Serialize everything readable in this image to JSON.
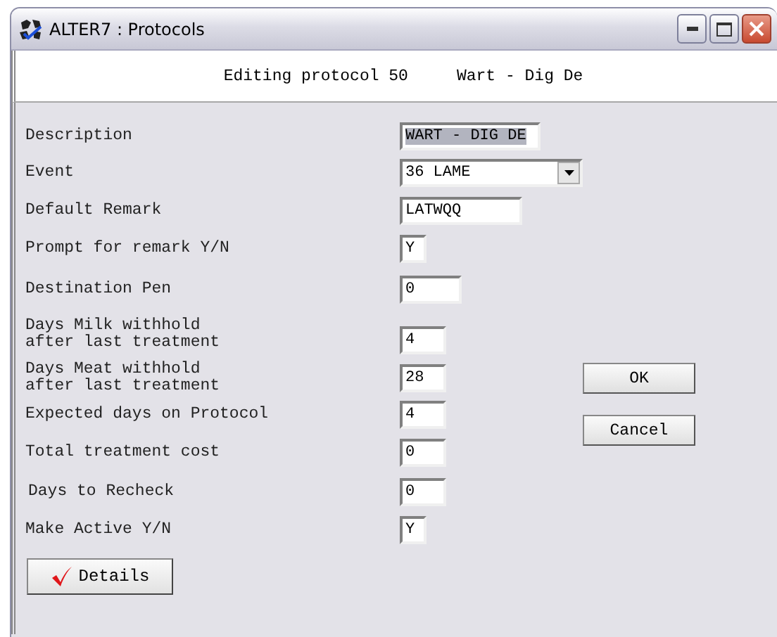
{
  "window": {
    "title": "ALTER7 : Protocols"
  },
  "header": {
    "text": "Editing protocol 50     Wart - Dig De"
  },
  "fields": [
    {
      "label": "Description",
      "kind": "text",
      "value": "WART - DIG DE",
      "highlighted": true
    },
    {
      "label": "Event",
      "kind": "dropdown",
      "value": "36 LAME",
      "highlighted": false
    },
    {
      "label": "Default Remark",
      "kind": "text",
      "value": "LATWQQ",
      "highlighted": false
    },
    {
      "label": "Prompt for remark Y/N",
      "kind": "text",
      "value": "Y",
      "highlighted": false
    },
    {
      "label": "Destination Pen",
      "kind": "text",
      "value": "0",
      "highlighted": false
    },
    {
      "label": "Days Milk withhold\nafter last treatment",
      "kind": "text",
      "value": "4",
      "highlighted": false
    },
    {
      "label": "Days Meat withhold\nafter last treatment",
      "kind": "text",
      "value": "28",
      "highlighted": false
    },
    {
      "label": "Expected days on Protocol",
      "kind": "text",
      "value": "4",
      "highlighted": false
    },
    {
      "label": "Total treatment cost",
      "kind": "text",
      "value": "0",
      "highlighted": false
    },
    {
      "label": "Days to Recheck",
      "kind": "text",
      "value": "0",
      "highlighted": false
    },
    {
      "label": "Make Active Y/N",
      "kind": "text",
      "value": "Y",
      "highlighted": false
    }
  ],
  "buttons": [
    "OK",
    "Cancel"
  ],
  "details_button": {
    "label": "Details"
  }
}
